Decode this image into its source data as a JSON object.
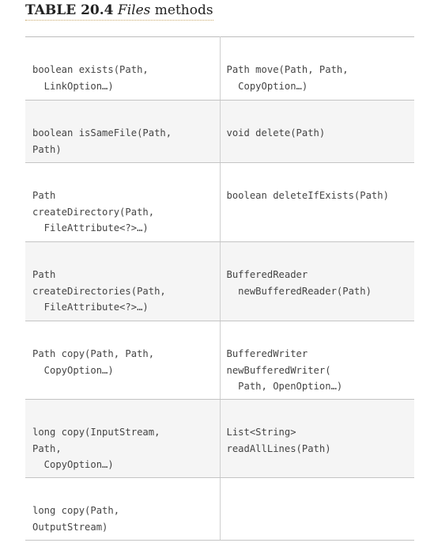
{
  "caption": {
    "label": "TABLE 20.4",
    "name": "Files",
    "suffix": "methods"
  },
  "rows": [
    {
      "left": [
        "boolean exists(Path,",
        "  LinkOption…)"
      ],
      "right": [
        "Path move(Path, Path,",
        "  CopyOption…)"
      ]
    },
    {
      "left": [
        "boolean isSameFile(Path,",
        "Path)"
      ],
      "right": [
        "void delete(Path)"
      ]
    },
    {
      "left": [
        "Path",
        "createDirectory(Path,",
        "  FileAttribute<?>…)"
      ],
      "right": [
        "boolean deleteIfExists(Path)"
      ]
    },
    {
      "left": [
        "Path",
        "createDirectories(Path,",
        "  FileAttribute<?>…)"
      ],
      "right": [
        "BufferedReader",
        "  newBufferedReader(Path)"
      ]
    },
    {
      "left": [
        "Path copy(Path, Path,",
        "  CopyOption…)"
      ],
      "right": [
        "BufferedWriter",
        "newBufferedWriter(",
        "  Path, OpenOption…)"
      ]
    },
    {
      "left": [
        "long copy(InputStream,",
        "Path,",
        "  CopyOption…)"
      ],
      "right": [
        "List<String>",
        "readAllLines(Path)"
      ]
    },
    {
      "left": [
        "long copy(Path,",
        "OutputStream)"
      ],
      "right": []
    }
  ]
}
